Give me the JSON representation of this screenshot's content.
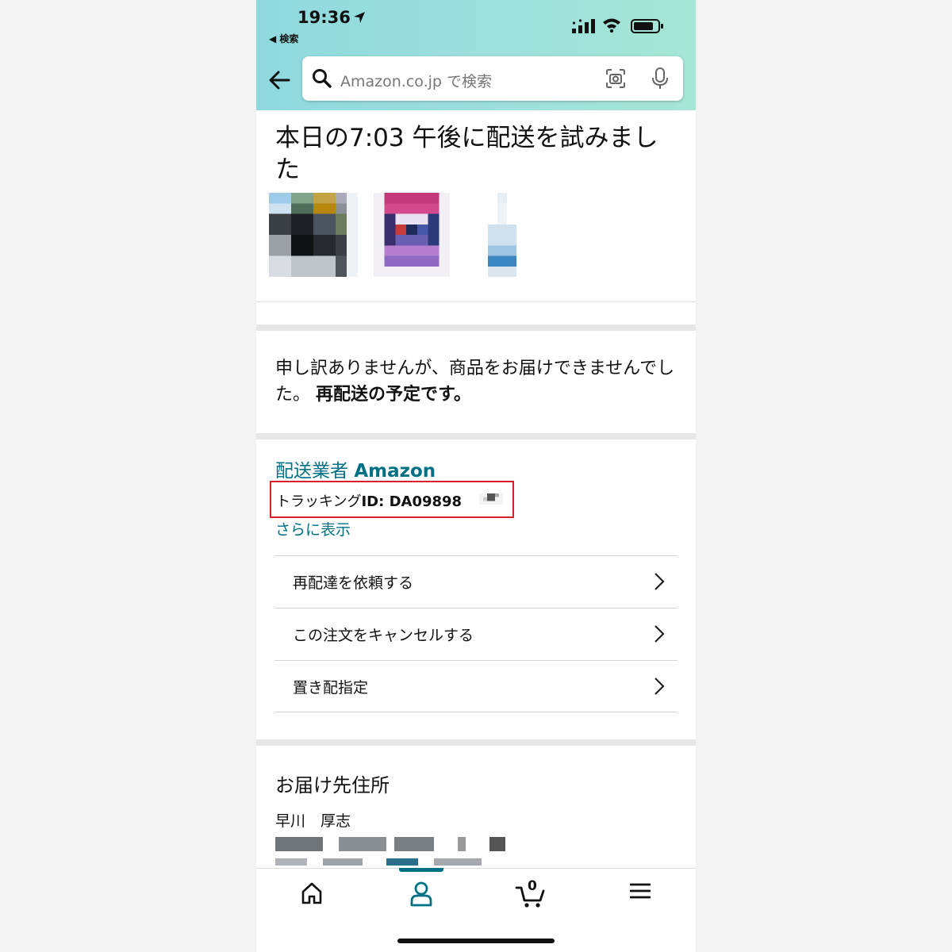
{
  "status_bar": {
    "time": "19:36",
    "back_app": "◀ 検索"
  },
  "search": {
    "placeholder": "Amazon.co.jp で検索"
  },
  "delivery": {
    "title": "本日の7:03 午後に配送を試みました",
    "sorry_text": "申し訳ありませんが、商品をお届けできませんでした。",
    "sorry_bold": "再配送の予定です。"
  },
  "carrier": {
    "label": "配送業者",
    "name": "Amazon",
    "tracking_label": "トラッキング",
    "tracking_id": "ID: DA09898",
    "more_link": "さらに表示"
  },
  "actions": [
    {
      "label": "再配達を依頼する"
    },
    {
      "label": "この注文をキャンセルする"
    },
    {
      "label": "置き配指定"
    }
  ],
  "address": {
    "title": "お届け先住所",
    "name": "早川　厚志"
  },
  "tabbar": {
    "cart_count": "0",
    "active_tab": "account",
    "accent_color": "#007185"
  },
  "icons": [
    "location-arrow-icon",
    "signal-icon",
    "wifi-icon",
    "battery-icon",
    "back-arrow-icon",
    "search-icon",
    "camera-icon",
    "mic-icon",
    "chevron-right-icon",
    "home-icon",
    "account-icon",
    "cart-icon",
    "menu-icon"
  ]
}
